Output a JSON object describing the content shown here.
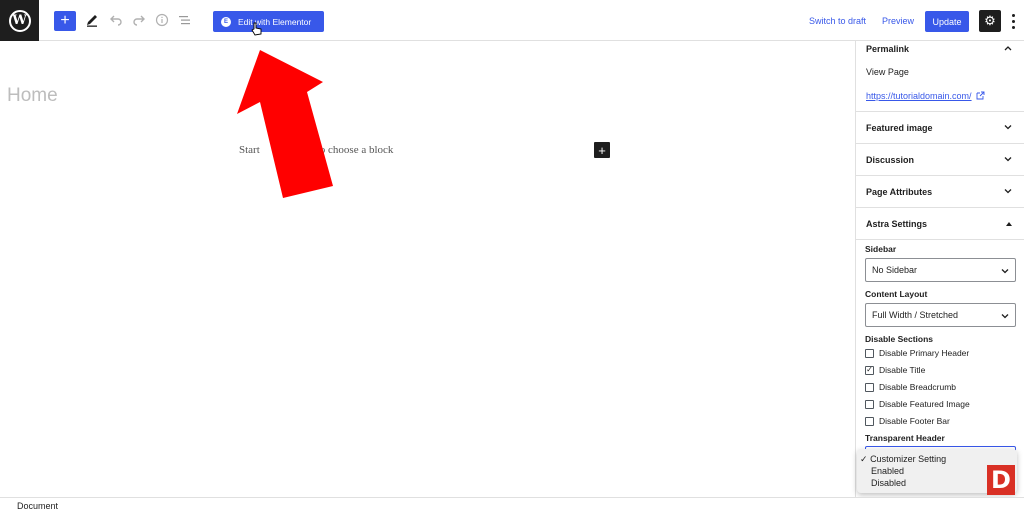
{
  "toolbar": {
    "elementor_label": "Edit with Elementor",
    "switch_draft": "Switch to draft",
    "preview": "Preview",
    "update": "Update"
  },
  "canvas": {
    "title": "Home",
    "hint_left": "Start",
    "hint_right": "pe / to choose a block"
  },
  "sidebar": {
    "permalink": {
      "title": "Permalink",
      "view_label": "View Page",
      "url": "https://tutorialdomain.com/"
    },
    "panels": [
      "Featured image",
      "Discussion",
      "Page Attributes"
    ],
    "astra": {
      "title": "Astra Settings",
      "sidebar_label": "Sidebar",
      "sidebar_value": "No Sidebar",
      "content_label": "Content Layout",
      "content_value": "Full Width / Stretched",
      "disable_label": "Disable Sections",
      "checks": [
        {
          "label": "Disable Primary Header",
          "checked": false
        },
        {
          "label": "Disable Title",
          "checked": true
        },
        {
          "label": "Disable Breadcrumb",
          "checked": false
        },
        {
          "label": "Disable Featured Image",
          "checked": false
        },
        {
          "label": "Disable Footer Bar",
          "checked": false
        }
      ],
      "transparent_label": "Transparent Header"
    }
  },
  "dropdown": {
    "options": [
      "Customizer Setting",
      "Enabled",
      "Disabled"
    ],
    "selected_mark": "✓"
  },
  "badge": "D",
  "footer": {
    "label": "Document"
  },
  "colors": {
    "accent": "#3858e9",
    "arrow": "#ff0000",
    "dark": "#1e1e1e"
  }
}
